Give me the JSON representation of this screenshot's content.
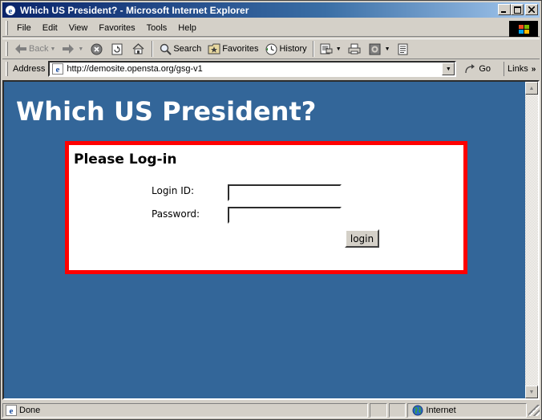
{
  "window": {
    "title": "Which US President? - Microsoft Internet Explorer",
    "buttons": {
      "minimize": "_",
      "maximize": "□",
      "close": "✕"
    }
  },
  "menubar": {
    "items": [
      {
        "label": "File"
      },
      {
        "label": "Edit"
      },
      {
        "label": "View"
      },
      {
        "label": "Favorites"
      },
      {
        "label": "Tools"
      },
      {
        "label": "Help"
      }
    ]
  },
  "toolbar": {
    "back_label": "Back",
    "search_label": "Search",
    "favorites_label": "Favorites",
    "history_label": "History"
  },
  "addressbar": {
    "label": "Address",
    "url": "http://demosite.opensta.org/gsg-v1",
    "go_label": "Go",
    "links_label": "Links"
  },
  "page": {
    "title": "Which US President?",
    "login": {
      "heading": "Please Log-in",
      "login_id_label": "Login ID:",
      "login_id_value": "",
      "password_label": "Password:",
      "password_value": "",
      "submit_label": "login"
    },
    "colors": {
      "background": "#336699",
      "box_border": "#ff0000",
      "title": "#ffffff"
    }
  },
  "statusbar": {
    "status": "Done",
    "zone": "Internet"
  }
}
